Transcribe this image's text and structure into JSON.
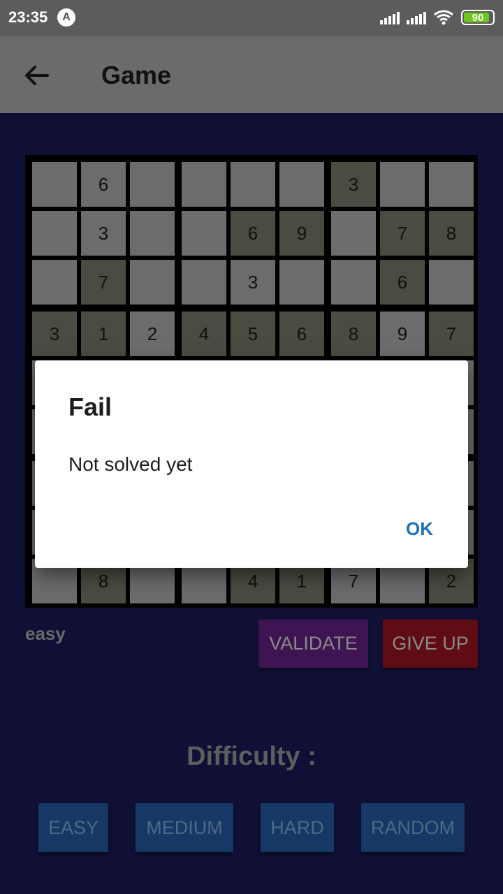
{
  "status_bar": {
    "time": "23:35",
    "app_icon": "app-notification-icon",
    "battery_level": 90,
    "battery_label": "90",
    "battery_color": "#6ec51e"
  },
  "app_bar": {
    "title": "Game",
    "back_icon": "arrow-left-icon"
  },
  "board": {
    "size": 9,
    "cells": [
      [
        "",
        "6",
        "",
        "",
        "",
        "",
        "3",
        "",
        ""
      ],
      [
        "",
        "3",
        "",
        "",
        "6",
        "9",
        "",
        "7",
        "8"
      ],
      [
        "",
        "7",
        "",
        "",
        "3",
        "",
        "",
        "6",
        ""
      ],
      [
        "3",
        "1",
        "2",
        "4",
        "5",
        "6",
        "8",
        "9",
        "7"
      ],
      [
        "",
        "",
        "",
        "",
        "",
        "",
        "",
        "",
        ""
      ],
      [
        "",
        "",
        "",
        "",
        "",
        "",
        "",
        "",
        ""
      ],
      [
        "",
        "",
        "",
        "",
        "",
        "",
        "",
        "",
        ""
      ],
      [
        "",
        "",
        "",
        "",
        "",
        "",
        "",
        "",
        ""
      ],
      [
        "",
        "8",
        "",
        "",
        "4",
        "1",
        "7",
        "",
        "2"
      ]
    ],
    "given": [
      [
        0,
        0,
        0,
        0,
        0,
        0,
        1,
        0,
        0
      ],
      [
        0,
        0,
        0,
        0,
        1,
        1,
        0,
        1,
        1
      ],
      [
        0,
        1,
        0,
        0,
        0,
        0,
        0,
        1,
        0
      ],
      [
        1,
        1,
        0,
        1,
        1,
        1,
        1,
        0,
        1
      ],
      [
        0,
        0,
        0,
        0,
        0,
        0,
        0,
        0,
        0
      ],
      [
        0,
        0,
        0,
        0,
        0,
        0,
        0,
        0,
        0
      ],
      [
        0,
        0,
        0,
        0,
        0,
        0,
        0,
        0,
        0
      ],
      [
        0,
        0,
        0,
        0,
        0,
        0,
        0,
        0,
        0
      ],
      [
        0,
        1,
        0,
        0,
        1,
        1,
        0,
        0,
        1
      ]
    ]
  },
  "current_difficulty": "easy",
  "actions": {
    "validate": "VALIDATE",
    "give_up": "GIVE UP"
  },
  "difficulty": {
    "heading": "Difficulty :",
    "options": [
      "EASY",
      "MEDIUM",
      "HARD",
      "RANDOM"
    ]
  },
  "dialog": {
    "title": "Fail",
    "message": "Not solved yet",
    "ok": "OK"
  },
  "colors": {
    "background": "#101036",
    "app_bar": "#6b6b6b",
    "given_cell": "#4a4c41",
    "empty_cell": "#6c6c6c",
    "validate": "#3e1453",
    "give_up": "#600c14",
    "difficulty_button": "#163865",
    "dialog_accent": "#1f6fb5"
  }
}
